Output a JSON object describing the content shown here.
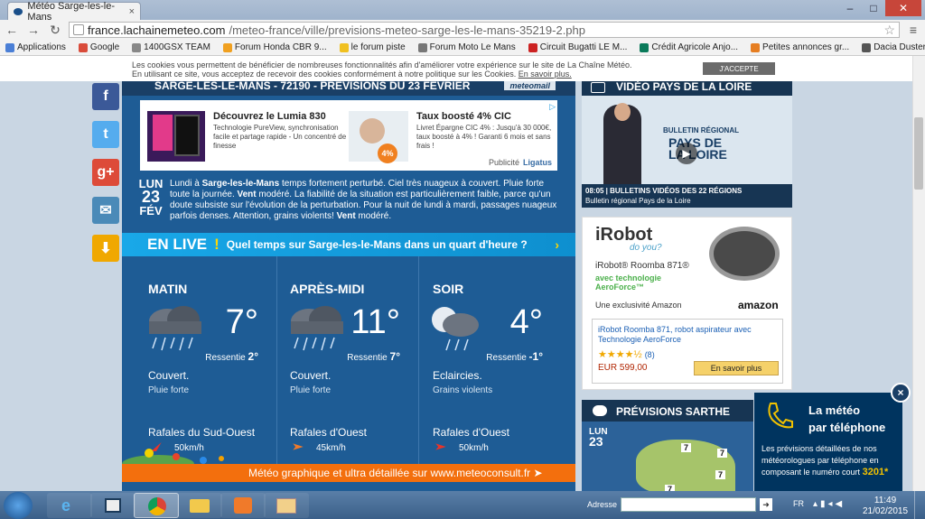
{
  "browser": {
    "tab_title": "Météo Sarge-les-le-Mans",
    "tab_close": "×",
    "url_host": "france.lachainemeteo.com",
    "url_path": "/meteo-france/ville/previsions-meteo-sarge-les-le-mans-35219-2.php",
    "window_buttons": [
      "–",
      "□",
      "✕"
    ]
  },
  "bookmarks": [
    {
      "label": "Applications",
      "color": "#4a7fd6"
    },
    {
      "label": "Google",
      "color": "#d94b3a"
    },
    {
      "label": "1400GSX TEAM",
      "color": "#888888"
    },
    {
      "label": "Forum Honda CBR 9...",
      "color": "#f0a020"
    },
    {
      "label": "le forum piste",
      "color": "#f0c020"
    },
    {
      "label": "Forum Moto Le Mans",
      "color": "#777777"
    },
    {
      "label": "Circuit Bugatti LE M...",
      "color": "#c22"
    },
    {
      "label": "Crédit Agricole Anjo...",
      "color": "#0a7a5a"
    },
    {
      "label": "Petites annonces gr...",
      "color": "#e67e22"
    },
    {
      "label": "Dacia Duster - Le Fo...",
      "color": "#555555"
    }
  ],
  "cookie": {
    "line1": "Les cookies vous permettent de bénéficier de nombreuses fonctionnalités afin d'améliorer votre expérience sur le site de La Chaîne Météo.",
    "line2": "En utilisant ce site, vous acceptez de recevoir des cookies conformément à notre politique sur les Cookies. ",
    "link": "En savoir plus.",
    "accept": "J'ACCEPTE"
  },
  "header": {
    "title": "SARGE-LES-LE-MANS - 72190 - PRÉVISIONS DU 23 FÉVRIER",
    "badge": "meteomail"
  },
  "ad1": {
    "left_title": "Découvrez le Lumia 830",
    "left_text": "Technologie PureView, synchronisation facile et partage rapide - Un concentré de finesse",
    "right_title": "Taux boosté 4% CIC",
    "right_text": "Livret Épargne CIC 4% : Jusqu'à 30 000€, taux boosté à 4% ! Garanti 6 mois et sans frais !",
    "badge": "4%",
    "footer_label": "Publicité",
    "footer_brand": "Ligatus"
  },
  "day": {
    "dow": "LUN",
    "num": "23",
    "month": "FÉV",
    "p1": "Lundi à ",
    "city": "Sarge-les-le-Mans",
    "p2": " temps fortement perturbé. Ciel très nuageux à couvert. Pluie forte toute la journée. ",
    "w1": "Vent",
    "p3": " modéré. La fiabilité de la situation est particulièrement faible, parce qu'un doute subsiste sur l'évolution de la perturbation. Pour la nuit de lundi à mardi, passages nuageux parfois denses. Attention, grains violents! ",
    "w2": "Vent",
    "p4": " modéré."
  },
  "enlive": {
    "title": "EN LIVE",
    "bang": "!",
    "question": "Quel temps sur Sarge-les-le-Mans dans un quart d'heure ?"
  },
  "periods": [
    {
      "name": "MATIN",
      "temp": "7°",
      "feel_label": "Ressentie",
      "feel": "2°",
      "cond": "Couvert.",
      "sub": "Pluie forte",
      "wind": "Rafales du Sud-Ouest",
      "speed": "50km/h"
    },
    {
      "name": "APRÈS-MIDI",
      "temp": "11°",
      "feel_label": "Ressentie",
      "feel": "7°",
      "cond": "Couvert.",
      "sub": "Pluie forte",
      "wind": "Rafales d'Ouest",
      "speed": "45km/h"
    },
    {
      "name": "SOIR",
      "temp": "4°",
      "feel_label": "Ressentie",
      "feel": "-1°",
      "cond": "Eclaircies.",
      "sub": "Grains violents",
      "wind": "Rafales d'Ouest",
      "speed": "50km/h"
    }
  ],
  "bottom_banner": "Météo graphique et ultra détaillée sur www.meteoconsult.fr ➤",
  "video": {
    "heading": "VIDÉO PAYS DE LA LOIRE",
    "bulletin": "BULLETIN RÉGIONAL",
    "region1": "PAYS DE",
    "region2": "LA LOIRE",
    "cap1": "08:05 | BULLETINS VIDÉOS DES 22 RÉGIONS",
    "cap2": "Bulletin régional Pays de la Loire"
  },
  "ad2": {
    "brand": "iRobot",
    "tagline": "do you?",
    "model": "iRobot® Roomba 871®",
    "tech": "avec technologie AeroForce™",
    "excl": "Une exclusivité Amazon",
    "amazon": "amazon",
    "link": "iRobot Roomba 871, robot aspirateur avec Technologie AeroForce",
    "stars": "★★★★½",
    "reviews": "(8)",
    "price": "EUR 599,00",
    "cta": "En savoir plus"
  },
  "prev": {
    "heading": "PRÉVISIONS SARTHE",
    "dow": "LUN",
    "num": "23",
    "temps": [
      "7",
      "7",
      "7",
      "7"
    ]
  },
  "phone": {
    "title1": "La météo",
    "title2": "par téléphone",
    "text": "Les prévisions détaillées de nos météorologues par téléphone en composant le numéro court",
    "number": "3201*",
    "close": "×"
  },
  "taskbar": {
    "addr_label": "Adresse",
    "lang": "FR",
    "time": "11:49",
    "date": "21/02/2015"
  }
}
